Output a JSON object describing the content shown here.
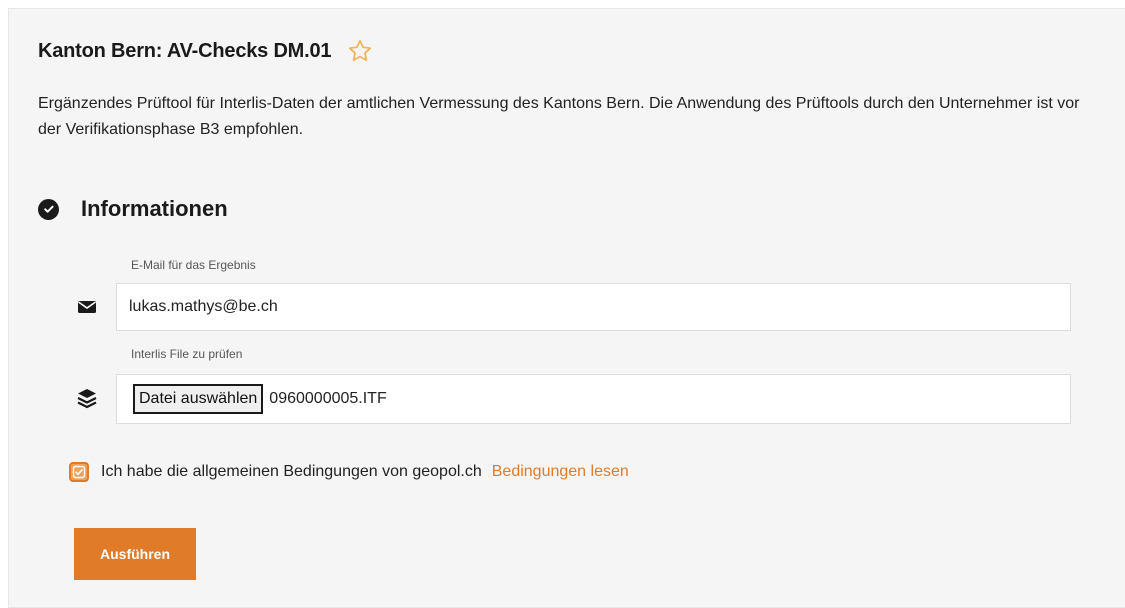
{
  "page": {
    "title": "Kanton Bern: AV-Checks DM.01",
    "description": "Ergänzendes Prüftool für Interlis-Daten der amtlichen Vermessung des Kantons Bern. Die Anwendung des Prüftools durch den Unternehmer ist vor der Verifikationsphase B3 empfohlen."
  },
  "section": {
    "title": "Informationen"
  },
  "email": {
    "label": "E-Mail für das Ergebnis",
    "value": "lukas.mathys@be.ch",
    "icon": "envelope-icon"
  },
  "file": {
    "label": "Interlis File zu prüfen",
    "button_label": "Datei auswählen",
    "file_name": "0960000005.ITF",
    "icon": "layers-icon"
  },
  "terms": {
    "checked": true,
    "text": "Ich habe die allgemeinen Bedingungen von geopol.ch",
    "link_label": "Bedingungen lesen"
  },
  "actions": {
    "run_label": "Ausführen"
  },
  "colors": {
    "accent": "#e07b2a",
    "panel_bg": "#f5f5f6",
    "text": "#1a1a1a"
  }
}
